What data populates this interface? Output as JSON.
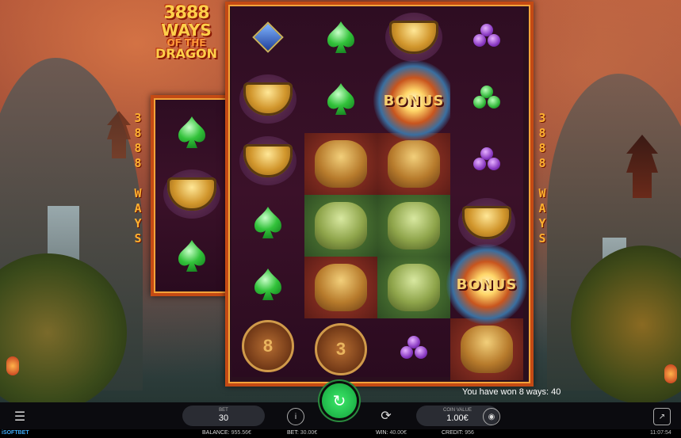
{
  "game": {
    "logo": {
      "line1": "3888",
      "line2": "WAYS",
      "line3": "OF THE",
      "line4": "DRAGON"
    },
    "side_text_left": [
      "3",
      "8",
      "8",
      "8",
      "",
      "W",
      "A",
      "Y",
      "S"
    ],
    "side_text_right": [
      "3",
      "8",
      "8",
      "8",
      "",
      "W",
      "A",
      "Y",
      "S"
    ],
    "bonus_label": "BONUS",
    "coin_left": "8",
    "coin_right": "3"
  },
  "win_message": "You have won 8 ways: 40",
  "controls": {
    "menu_icon": "hamburger-icon",
    "bet_label": "BET",
    "bet_value": "30",
    "info_icon": "info-icon",
    "spin_icon": "refresh-icon",
    "autoplay_icon": "autoplay-icon",
    "coin_label": "COIN VALUE",
    "coin_value": "1.00€",
    "coins_icon": "coins-icon",
    "exit_icon": "exit-icon"
  },
  "status": {
    "brand": "iSOFTBET",
    "balance_label": "BALANCE:",
    "balance_value": "955.56€",
    "bet_label": "BET:",
    "bet_value": "30.00€",
    "win_label": "WIN:",
    "win_value": "40.00€",
    "credit_label": "CREDIT:",
    "credit_value": "956",
    "time": "11:07:54"
  },
  "colors": {
    "frame": "#c44a14",
    "spin": "#1fc24a",
    "gold": "#ffb230"
  }
}
